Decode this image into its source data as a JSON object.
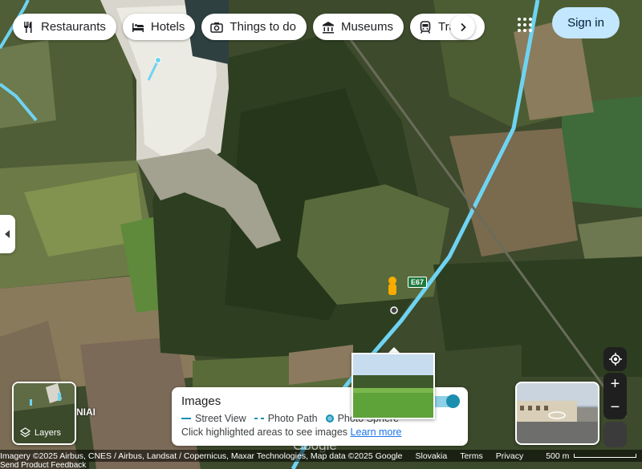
{
  "chips": [
    {
      "label": "Restaurants",
      "icon": "restaurant-icon"
    },
    {
      "label": "Hotels",
      "icon": "hotel-icon"
    },
    {
      "label": "Things to do",
      "icon": "camera-icon"
    },
    {
      "label": "Museums",
      "icon": "museum-icon"
    },
    {
      "label": "Transit",
      "icon": "transit-icon"
    }
  ],
  "header": {
    "signin_label": "Sign in"
  },
  "layers": {
    "label": "Layers"
  },
  "images_panel": {
    "title": "Images",
    "legend_street_view": "Street View",
    "legend_photo_path": "Photo Path",
    "legend_photo_sphere": "Photo Sphere",
    "hint_text": "Click highlighted areas to see images",
    "hint_link": "Learn more",
    "toggle_on": true
  },
  "map_labels": {
    "route": "E67",
    "place_partial": "NIAI",
    "town_partial": "Šeduva",
    "watermark": "Google"
  },
  "attribution": {
    "imagery": "Imagery ©2025 Airbus, CNES / Airbus, Landsat / Copernicus, Maxar Technologies, Map data ©2025 Google",
    "country": "Slovakia",
    "terms": "Terms",
    "privacy": "Privacy",
    "scale": "500 m",
    "feedback": "Send Product Feedback"
  },
  "colors": {
    "road_highlight": "#6fd3f2",
    "signin_bg": "#c2e7ff",
    "accent": "#1a8fb5"
  }
}
